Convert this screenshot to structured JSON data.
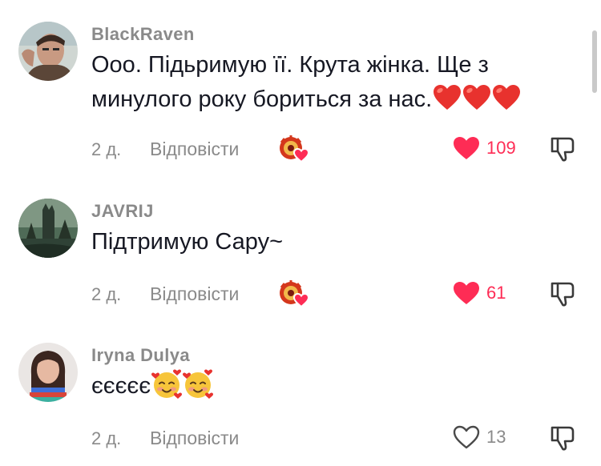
{
  "colors": {
    "like_active": "#fe2c55",
    "text_muted": "#8a8a8a",
    "text_main": "#161823"
  },
  "comments": [
    {
      "username": "BlackRaven",
      "text": "Ооо. Підьримую її. Крута жінка. Ще з минулого року бориться за нас.",
      "emojis": [
        "red-heart",
        "red-heart",
        "red-heart"
      ],
      "time": "2 д.",
      "reply_label": "Відповісти",
      "creator_liked": true,
      "likes": "109",
      "liked": true
    },
    {
      "username": "JAVRIJ",
      "text": "Підтримую Сару~",
      "emojis": [],
      "time": "2 д.",
      "reply_label": "Відповісти",
      "creator_liked": true,
      "likes": "61",
      "liked": true
    },
    {
      "username": "Iryna Dulya",
      "text": "єєєєє",
      "emojis": [
        "smiling-face-with-hearts",
        "smiling-face-with-hearts"
      ],
      "time": "2 д.",
      "reply_label": "Відповісти",
      "creator_liked": false,
      "likes": "13",
      "liked": false
    }
  ]
}
